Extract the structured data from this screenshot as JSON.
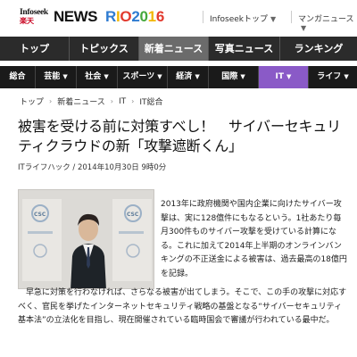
{
  "header": {
    "logo_top": "Infoseek",
    "logo_bottom": "楽天",
    "news_label": "NEWS",
    "rio_label": "RIO2016",
    "links": [
      {
        "label": "Infoseekトップ"
      },
      {
        "label": "マンガニュース"
      }
    ]
  },
  "main_nav": [
    {
      "label": "トップ"
    },
    {
      "label": "トピックス"
    },
    {
      "label": "新着ニュース",
      "active": true
    },
    {
      "label": "写真ニュース"
    },
    {
      "label": "ランキング"
    }
  ],
  "sub_nav": [
    {
      "label": "総合"
    },
    {
      "label": "芸能"
    },
    {
      "label": "社会"
    },
    {
      "label": "スポーツ"
    },
    {
      "label": "経済"
    },
    {
      "label": "国際"
    },
    {
      "label": "IT",
      "active": true
    },
    {
      "label": "ライフ"
    }
  ],
  "breadcrumb": [
    "トップ",
    "新着ニュース",
    "IT",
    "IT総合"
  ],
  "article": {
    "title": "被害を受ける前に対策すべし！　サイバーセキュリティクラウドの新「攻撃遮断くん」",
    "source": "ITライフハック",
    "date": "2014年10月30日 9時0分",
    "paragraph1": "2013年に政府機関や国内企業に向けたサイバー攻撃は、実に128億件にもなるという。1社あたり毎月300件ものサイバー攻撃を受けている計算になる。これに加えて2014年上半期のオンラインバンキングの不正送金による被害は、過去最高の18億円を記録。",
    "paragraph2": "早急に対策を行わなければ、さらなる被害が出てしまう。そこで、この手の攻撃に対応すべく、官民を挙げたインターネットセキュリティ戦略の基盤となる“サイバーセキュリティ基本法”の立法化を目指し、現在開催されている臨時国会で審議が行われている最中だ。",
    "photo_logo_text": "CSC"
  },
  "colors": {
    "main_nav_bg": "#2b2b2b",
    "main_nav_active": "#6b6b6b",
    "sub_nav_bg": "#1a1a1a",
    "sub_nav_active": "#8a5ac7",
    "brand_red": "#c8001e"
  }
}
